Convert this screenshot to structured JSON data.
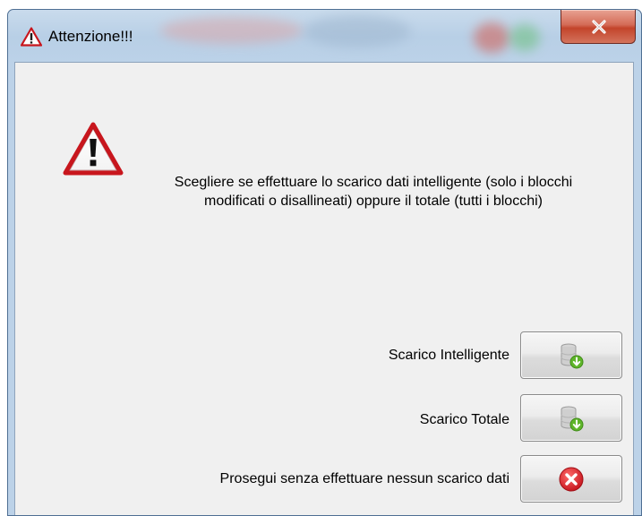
{
  "window": {
    "title": "Attenzione!!!",
    "close_icon": "close-x-icon"
  },
  "dialog": {
    "message": "Scegliere se effettuare lo scarico dati intelligente (solo i blocchi modificati o disallineati) oppure il totale (tutti i blocchi)",
    "warning_icon": "warning-triangle-icon",
    "options": [
      {
        "label": "Scarico Intelligente",
        "icon": "database-download-icon"
      },
      {
        "label": "Scarico Totale",
        "icon": "database-download-icon"
      },
      {
        "label": "Prosegui senza effettuare nessun scarico dati",
        "icon": "cancel-red-icon"
      }
    ]
  },
  "colors": {
    "titlebar": "#bcd2e8",
    "client_bg": "#f0f0f0",
    "close_red": "#c3442b",
    "warning_red": "#c8161d",
    "cancel_red": "#e0262e",
    "download_green": "#5fb52a"
  }
}
